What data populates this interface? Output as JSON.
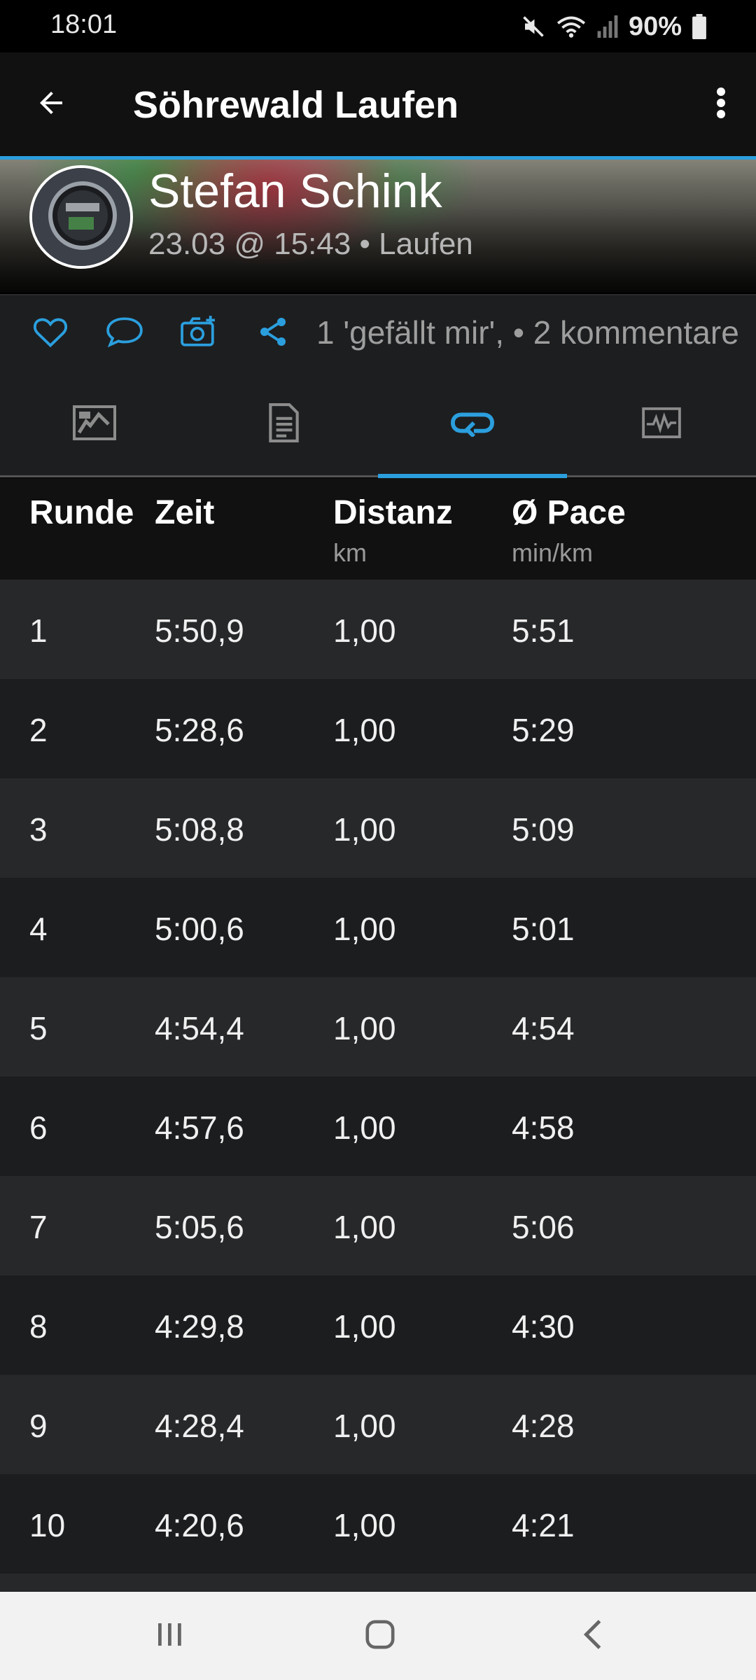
{
  "status_bar": {
    "time": "18:01",
    "battery": "90%",
    "icons": [
      "mute-icon",
      "wifi-icon",
      "signal-icon",
      "battery-icon"
    ]
  },
  "app_bar": {
    "title": "Söhrewald Laufen",
    "icons": [
      "back-arrow-icon",
      "more-vert-icon"
    ]
  },
  "header": {
    "user_name": "Stefan Schink",
    "meta": "23.03 @ 15:43 • Laufen"
  },
  "social": {
    "summary": "1 'gefällt mir', • 2 kommentare",
    "icons": [
      "heart-icon",
      "comment-icon",
      "add-photo-icon",
      "share-icon"
    ]
  },
  "tabs": {
    "icons": [
      "map-icon",
      "details-icon",
      "laps-icon",
      "chart-icon"
    ],
    "selected": "laps-icon"
  },
  "colors": {
    "accent": "#2b9fde",
    "background": "#111111",
    "row_light": "#27282a",
    "row_dark": "#1c1d1f"
  },
  "table": {
    "headers": {
      "lap": "Runde",
      "time": "Zeit",
      "distance": "Distanz",
      "distance_unit": "km",
      "pace": "Ø Pace",
      "pace_unit": "min/km"
    },
    "rows": [
      {
        "lap": "1",
        "time": "5:50,9",
        "distance": "1,00",
        "pace": "5:51"
      },
      {
        "lap": "2",
        "time": "5:28,6",
        "distance": "1,00",
        "pace": "5:29"
      },
      {
        "lap": "3",
        "time": "5:08,8",
        "distance": "1,00",
        "pace": "5:09"
      },
      {
        "lap": "4",
        "time": "5:00,6",
        "distance": "1,00",
        "pace": "5:01"
      },
      {
        "lap": "5",
        "time": "4:54,4",
        "distance": "1,00",
        "pace": "4:54"
      },
      {
        "lap": "6",
        "time": "4:57,6",
        "distance": "1,00",
        "pace": "4:58"
      },
      {
        "lap": "7",
        "time": "5:05,6",
        "distance": "1,00",
        "pace": "5:06"
      },
      {
        "lap": "8",
        "time": "4:29,8",
        "distance": "1,00",
        "pace": "4:30"
      },
      {
        "lap": "9",
        "time": "4:28,4",
        "distance": "1,00",
        "pace": "4:28"
      },
      {
        "lap": "10",
        "time": "4:20,6",
        "distance": "1,00",
        "pace": "4:21"
      }
    ]
  },
  "nav_bar": {
    "icons": [
      "recent-apps-icon",
      "home-icon",
      "back-nav-icon"
    ]
  }
}
